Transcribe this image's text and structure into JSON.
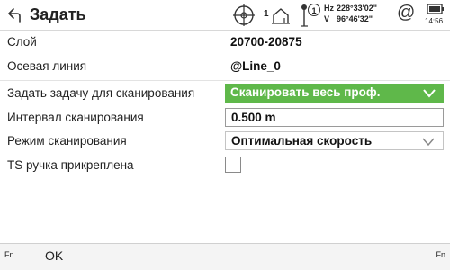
{
  "header": {
    "title": "Задать",
    "hand_label": "1",
    "prism_label": "1",
    "hz_label": "Hz",
    "hz_value": "228°33'02\"",
    "v_label": "V",
    "v_value": "96°46'32\"",
    "at_symbol": "@",
    "time": "14:56",
    "icons": [
      "back-arrow-icon",
      "crosshair-icon",
      "hand-icon",
      "prism-icon",
      "at-icon",
      "battery-icon"
    ]
  },
  "form": {
    "layer": {
      "label": "Слой",
      "value": "20700-20875"
    },
    "centerline": {
      "label": "Осевая линия",
      "value": "@Line_0"
    },
    "task": {
      "label": "Задать задачу для сканирования",
      "value": "Сканировать весь проф."
    },
    "interval": {
      "label": "Интервал сканирования",
      "value": "0.500 m"
    },
    "mode": {
      "label": "Режим сканирования",
      "value": "Оптимальная скорость"
    },
    "handle": {
      "label": "TS ручка прикреплена",
      "checked": false
    }
  },
  "footer": {
    "fn_left": "Fn",
    "ok": "OK",
    "fn_right": "Fn"
  },
  "colors": {
    "accent_green": "#5fb84a"
  }
}
